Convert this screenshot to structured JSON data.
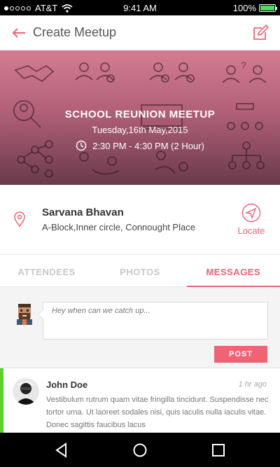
{
  "status_bar": {
    "carrier": "AT&T",
    "time": "9:41 AM",
    "battery": "100%"
  },
  "header": {
    "title": "Create Meetup"
  },
  "event": {
    "title": "SCHOOL REUNION MEETUP",
    "date": "Tuesday,16th May,2015",
    "time": "2:30 PM - 4:30 PM (2 Hour)"
  },
  "location": {
    "name": "Sarvana Bhavan",
    "address": "A-Block,Inner circle, Connought Place",
    "locate_label": "Locate"
  },
  "tabs": [
    {
      "label": "ATTENDEES",
      "active": false
    },
    {
      "label": "PHOTOS",
      "active": false
    },
    {
      "label": "MESSAGES",
      "active": true
    }
  ],
  "composer": {
    "placeholder": "Hey when can we catch up...",
    "post_label": "POST"
  },
  "messages": [
    {
      "author": "John Doe",
      "time": "1 hr ago",
      "text": "Vestibulum rutrum quam vitae fringilla tincidunt. Suspendisse nec tortor urna. Ut laoreet sodales nisi, quis iaculis nulla iaculis vitae. Donec sagittis faucibus lacus"
    }
  ],
  "colors": {
    "accent": "#f06275",
    "unread_bar": "#5bd02f",
    "hero_top": "#d47c93",
    "hero_bottom": "#6a3a4a"
  },
  "icons": {
    "back": "arrow-left-icon",
    "edit": "edit-icon",
    "clock": "clock-icon",
    "pin": "location-pin-icon",
    "locate": "navigation-arrow-icon"
  }
}
